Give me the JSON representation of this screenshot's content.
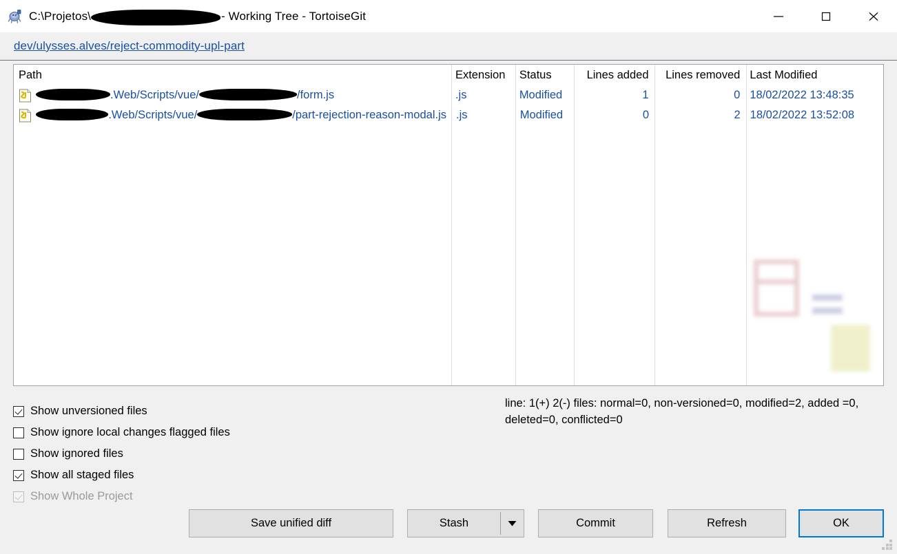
{
  "window": {
    "title_prefix": "C:\\Projetos\\",
    "title_suffix": "- Working Tree - TortoiseGit",
    "app_icon": "tortoisegit-turtle-icon",
    "minimize_label": "Minimize",
    "maximize_label": "Maximize",
    "close_label": "Close"
  },
  "branch": {
    "link": "dev/ulysses.alves/reject-commodity-upl-part"
  },
  "file_list": {
    "columns": [
      "Path",
      "Extension",
      "Status",
      "Lines added",
      "Lines removed",
      "Last Modified"
    ],
    "rows": [
      {
        "icon": "javascript-file-icon",
        "path_part1": ".Web/Scripts/vue/",
        "path_part2": "/form.js",
        "extension": ".js",
        "status": "Modified",
        "lines_added": "1",
        "lines_removed": "0",
        "last_modified": "18/02/2022 13:48:35"
      },
      {
        "icon": "javascript-file-icon",
        "path_part1": ".Web/Scripts/vue/",
        "path_part2": "/part-rejection-reason-modal.js",
        "extension": ".js",
        "status": "Modified",
        "lines_added": "0",
        "lines_removed": "2",
        "last_modified": "18/02/2022 13:52:08"
      }
    ]
  },
  "options": [
    {
      "label": "Show unversioned files",
      "checked": true,
      "disabled": false
    },
    {
      "label": "Show ignore local changes flagged files",
      "checked": false,
      "disabled": false
    },
    {
      "label": "Show ignored files",
      "checked": false,
      "disabled": false
    },
    {
      "label": "Show all staged files",
      "checked": true,
      "disabled": false
    },
    {
      "label": "Show Whole Project",
      "checked": true,
      "disabled": true
    }
  ],
  "status": {
    "text": "line: 1(+) 2(-) files: normal=0, non-versioned=0, modified=2, added =0, deleted=0, conflicted=0"
  },
  "buttons": {
    "save_unified_diff": "Save unified diff",
    "stash": "Stash",
    "stash_dropdown_icon": "chevron-down-icon",
    "commit": "Commit",
    "refresh": "Refresh",
    "ok": "OK"
  },
  "colors": {
    "link": "#1a4fa0",
    "focus_border": "#0078d7",
    "body_bg": "#f0f0f0"
  }
}
